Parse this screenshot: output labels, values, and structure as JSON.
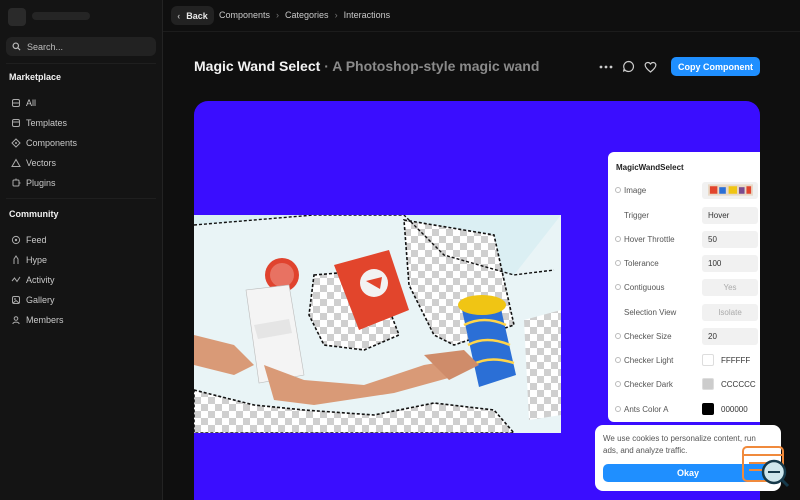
{
  "sidebar": {
    "search_placeholder": "Search...",
    "marketplace_title": "Marketplace",
    "marketplace_items": [
      {
        "label": "All",
        "icon": "layers-icon"
      },
      {
        "label": "Templates",
        "icon": "template-icon"
      },
      {
        "label": "Components",
        "icon": "component-icon"
      },
      {
        "label": "Vectors",
        "icon": "vector-icon"
      },
      {
        "label": "Plugins",
        "icon": "plugin-icon"
      }
    ],
    "community_title": "Community",
    "community_items": [
      {
        "label": "Feed",
        "icon": "feed-icon"
      },
      {
        "label": "Hype",
        "icon": "hype-icon"
      },
      {
        "label": "Activity",
        "icon": "activity-icon"
      },
      {
        "label": "Gallery",
        "icon": "gallery-icon"
      },
      {
        "label": "Members",
        "icon": "members-icon"
      }
    ]
  },
  "topbar": {
    "back_label": "Back",
    "breadcrumbs": [
      "Components",
      "Categories",
      "Interactions"
    ]
  },
  "header": {
    "title": "Magic Wand Select",
    "subtitle": "· A Photoshop-style magic wand",
    "copy_label": "Copy Component"
  },
  "panel": {
    "title": "MagicWandSelect",
    "rows": [
      {
        "label": "Image",
        "value": ""
      },
      {
        "label": "Trigger",
        "value": "Hover"
      },
      {
        "label": "Hover Throttle",
        "value": "50"
      },
      {
        "label": "Tolerance",
        "value": "100"
      },
      {
        "label": "Contiguous",
        "value": "Yes"
      },
      {
        "label": "Selection View",
        "value": "Isolate"
      },
      {
        "label": "Checker Size",
        "value": "20"
      },
      {
        "label": "Checker Light",
        "value": "FFFFFF",
        "color": "#FFFFFF"
      },
      {
        "label": "Checker Dark",
        "value": "CCCCCC",
        "color": "#CCCCCC"
      },
      {
        "label": "Ants Color A",
        "value": "000000",
        "color": "#000000"
      }
    ]
  },
  "cookie": {
    "text": "We use cookies to personalize content, run ads, and analyze traffic.",
    "ok_label": "Okay"
  },
  "colors": {
    "accent": "#1F8FFF",
    "canvas": "#3A0DFF"
  }
}
